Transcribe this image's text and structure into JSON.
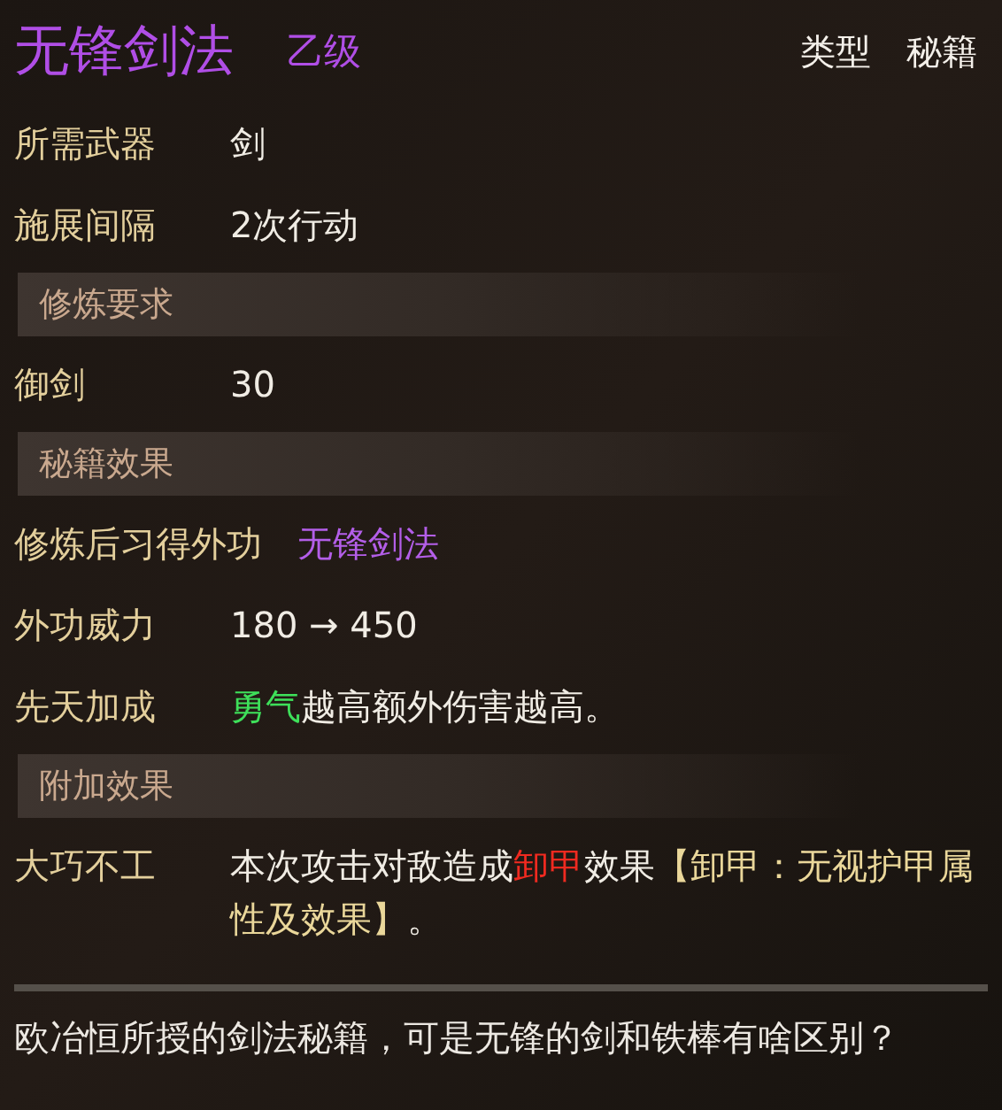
{
  "title": {
    "name": "无锋剑法",
    "grade": "乙级",
    "type_label": "类型",
    "type_value": "秘籍"
  },
  "blocks": [
    {
      "kind": "row",
      "label": "所需武器",
      "value": [
        {
          "text": "剑",
          "color": "#f0ece4"
        }
      ]
    },
    {
      "kind": "row",
      "label": "施展间隔",
      "value": [
        {
          "text": "2次行动",
          "color": "#f0ece4"
        }
      ]
    },
    {
      "kind": "header",
      "text": "修炼要求"
    },
    {
      "kind": "row",
      "label": "御剑",
      "value": [
        {
          "text": "30",
          "color": "#f0ece4"
        }
      ]
    },
    {
      "kind": "header",
      "text": "秘籍效果"
    },
    {
      "kind": "row",
      "label": "修炼后习得外功",
      "value": [
        {
          "text": "无锋剑法",
          "color": "#b35ee8"
        }
      ]
    },
    {
      "kind": "row",
      "label": "外功威力",
      "value": [
        {
          "text": "180 → 450",
          "color": "#f0ece4"
        }
      ]
    },
    {
      "kind": "row",
      "label": "先天加成",
      "value": [
        {
          "text": "勇气",
          "color": "#3ee05a"
        },
        {
          "text": "越高额外伤害越高。",
          "color": "#f0ece4"
        }
      ]
    },
    {
      "kind": "header",
      "text": "附加效果"
    },
    {
      "kind": "row",
      "label": "大巧不工",
      "value": [
        {
          "text": "本次攻击对敌造成",
          "color": "#f0ece4"
        },
        {
          "text": "卸甲",
          "color": "#f02a20"
        },
        {
          "text": "效果",
          "color": "#f0ece4"
        },
        {
          "text": "【卸甲：无视护甲属性及效果】",
          "color": "#ead79a"
        },
        {
          "text": "。",
          "color": "#f0ece4"
        }
      ]
    }
  ],
  "description": "欧冶恒所授的剑法秘籍，可是无锋的剑和铁棒有啥区别？"
}
